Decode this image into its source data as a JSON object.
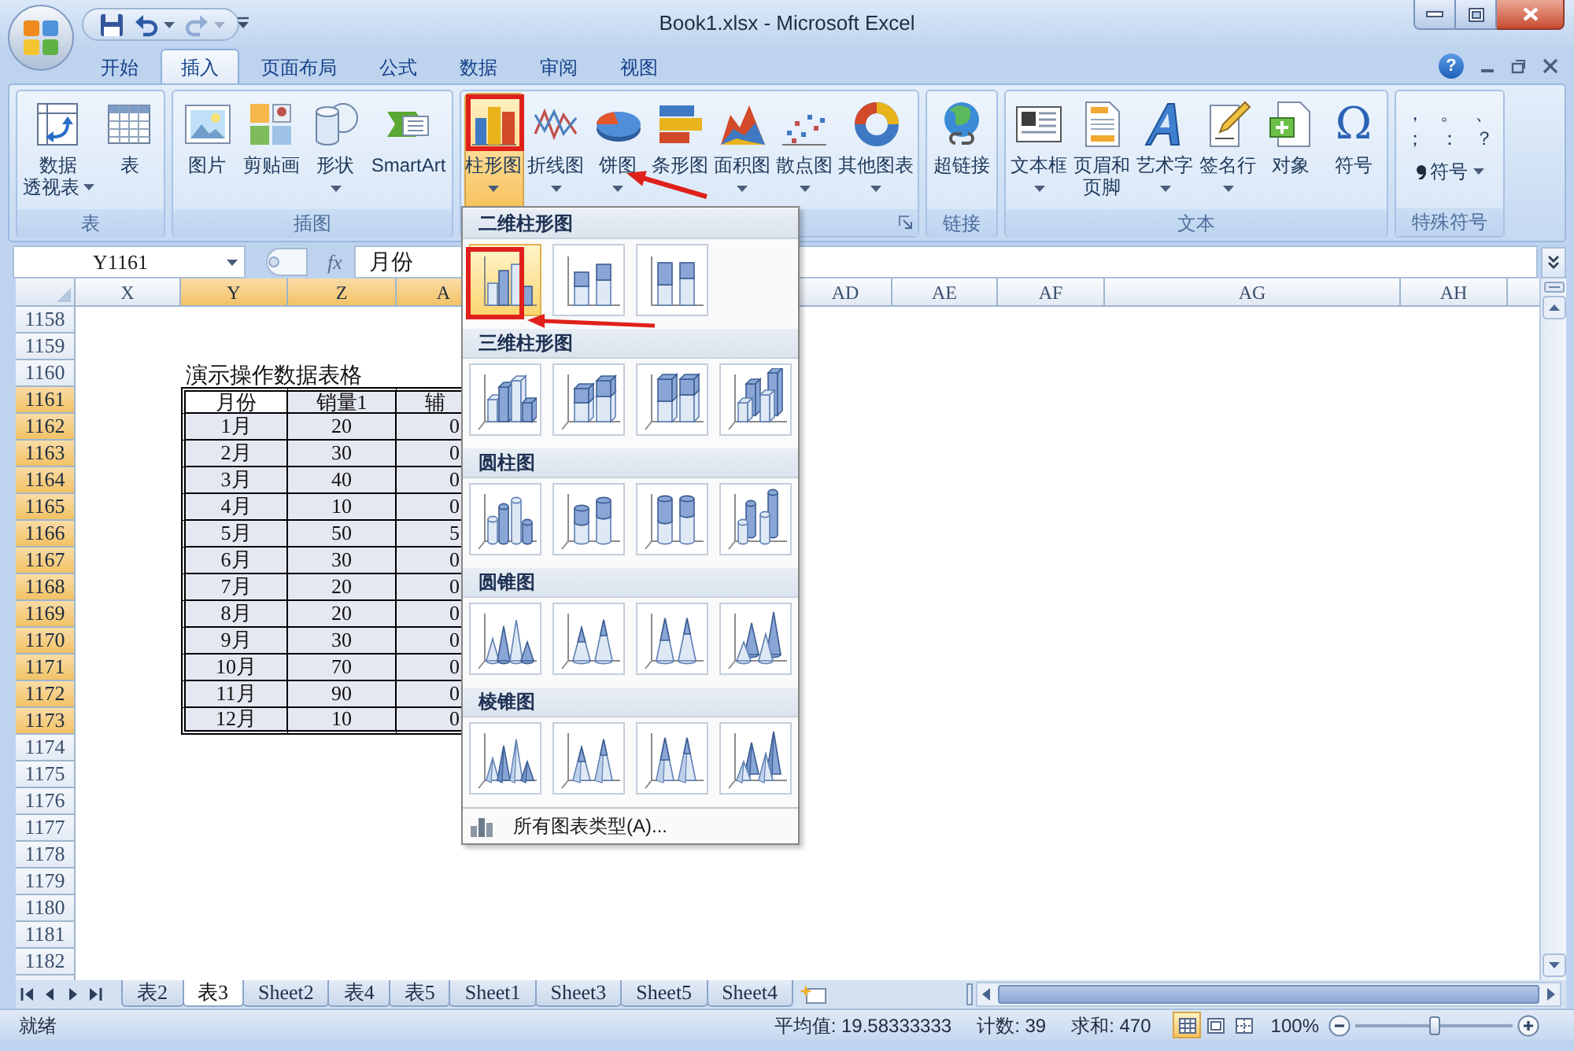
{
  "window": {
    "title": "Book1.xlsx - Microsoft Excel"
  },
  "quick_access": [
    {
      "kind": "save",
      "disabled": false
    },
    {
      "kind": "undo",
      "disabled": false
    },
    {
      "kind": "redo",
      "disabled": true
    }
  ],
  "ribbon_tabs": [
    {
      "label": "开始",
      "selected": false
    },
    {
      "label": "插入",
      "selected": true
    },
    {
      "label": "页面布局",
      "selected": false
    },
    {
      "label": "公式",
      "selected": false
    },
    {
      "label": "数据",
      "selected": false
    },
    {
      "label": "审阅",
      "selected": false
    },
    {
      "label": "视图",
      "selected": false
    }
  ],
  "ribbon_controls": {
    "help": "?"
  },
  "ribbon_groups": [
    {
      "label": "表",
      "launcher": false,
      "items": [
        {
          "kind": "pivot",
          "label": [
            "数据",
            "透视表"
          ],
          "dropdown": true,
          "selected": false
        },
        {
          "kind": "table",
          "label": [
            "表"
          ],
          "dropdown": false,
          "selected": false
        }
      ]
    },
    {
      "label": "插图",
      "launcher": false,
      "items": [
        {
          "kind": "picture",
          "label": [
            "图片"
          ],
          "dropdown": false,
          "selected": false
        },
        {
          "kind": "clipart",
          "label": [
            "剪贴画"
          ],
          "dropdown": false,
          "selected": false
        },
        {
          "kind": "shapes",
          "label": [
            "形状"
          ],
          "dropdown": true,
          "selected": false
        },
        {
          "kind": "smartart",
          "label": [
            "SmartArt"
          ],
          "dropdown": false,
          "selected": false
        }
      ]
    },
    {
      "launcher": true,
      "items": [
        {
          "kind": "column",
          "label": [
            "柱形图"
          ],
          "dropdown": true,
          "selected": true
        },
        {
          "kind": "line",
          "label": [
            "折线图"
          ],
          "dropdown": true,
          "selected": false
        },
        {
          "kind": "pie",
          "label": [
            "饼图"
          ],
          "dropdown": true,
          "selected": false
        },
        {
          "kind": "bar",
          "label": [
            "条形图"
          ],
          "dropdown": false,
          "selected": false
        },
        {
          "kind": "area",
          "label": [
            "面积图"
          ],
          "dropdown": true,
          "selected": false
        },
        {
          "kind": "scatter",
          "label": [
            "散点图"
          ],
          "dropdown": true,
          "selected": false
        },
        {
          "kind": "other",
          "label": [
            "其他图表"
          ],
          "dropdown": true,
          "selected": false
        }
      ]
    },
    {
      "label": "链接",
      "launcher": false,
      "items": [
        {
          "kind": "hyperlink",
          "label": [
            "超链接"
          ],
          "dropdown": false,
          "selected": false
        }
      ]
    },
    {
      "label": "文本",
      "launcher": false,
      "items": [
        {
          "kind": "textbox",
          "label": [
            "文本框"
          ],
          "dropdown": true,
          "selected": false
        },
        {
          "kind": "header",
          "label": [
            "页眉和",
            "页脚"
          ],
          "dropdown": false,
          "selected": false
        },
        {
          "kind": "wordart",
          "label": [
            "艺术字"
          ],
          "dropdown": true,
          "selected": false
        },
        {
          "kind": "signature",
          "label": [
            "签名行"
          ],
          "dropdown": true,
          "selected": false
        },
        {
          "kind": "object",
          "label": [
            "对象"
          ],
          "dropdown": false,
          "selected": false
        },
        {
          "kind": "symbol",
          "label": [
            "符号"
          ],
          "glyph": "Ω",
          "dropdown": false,
          "selected": false
        }
      ]
    },
    {
      "label": "特殊符号",
      "launcher": false,
      "symbols": [
        "，",
        "。",
        "、",
        "；",
        "：",
        "？"
      ],
      "menu": {
        "label": "符号",
        "dropdown": true
      }
    }
  ],
  "formula_bar": {
    "name_box": "Y1161",
    "function_label": "fx",
    "content": "月份"
  },
  "sheet": {
    "columns": [
      {
        "label": "X",
        "selected": false
      },
      {
        "label": "Y",
        "selected": true
      },
      {
        "label": "Z",
        "selected": true
      },
      {
        "label": "A",
        "selected": true
      },
      {
        "label": "AD",
        "selected": false
      },
      {
        "label": "AE",
        "selected": false
      },
      {
        "label": "AF",
        "selected": false
      },
      {
        "label": "AG",
        "selected": false
      },
      {
        "label": "AH",
        "selected": false
      }
    ],
    "rows": [
      {
        "label": "1158",
        "selected": false
      },
      {
        "label": "1159",
        "selected": false
      },
      {
        "label": "1160",
        "selected": false
      },
      {
        "label": "1161",
        "selected": true
      },
      {
        "label": "1162",
        "selected": true
      },
      {
        "label": "1163",
        "selected": true
      },
      {
        "label": "1164",
        "selected": true
      },
      {
        "label": "1165",
        "selected": true
      },
      {
        "label": "1166",
        "selected": true
      },
      {
        "label": "1167",
        "selected": true
      },
      {
        "label": "1168",
        "selected": true
      },
      {
        "label": "1169",
        "selected": true
      },
      {
        "label": "1170",
        "selected": true
      },
      {
        "label": "1171",
        "selected": true
      },
      {
        "label": "1172",
        "selected": true
      },
      {
        "label": "1173",
        "selected": true
      },
      {
        "label": "1174",
        "selected": false
      },
      {
        "label": "1175",
        "selected": false
      },
      {
        "label": "1176",
        "selected": false
      },
      {
        "label": "1177",
        "selected": false
      },
      {
        "label": "1178",
        "selected": false
      },
      {
        "label": "1179",
        "selected": false
      },
      {
        "label": "1180",
        "selected": false
      },
      {
        "label": "1181",
        "selected": false
      },
      {
        "label": "1182",
        "selected": false
      }
    ],
    "table": {
      "title": "演示操作数据表格",
      "header": [
        {
          "text": "月份",
          "active": true
        },
        {
          "text": "销量1",
          "active": false
        },
        {
          "text": "辅",
          "active": false
        }
      ],
      "rows": [
        [
          "1月",
          "20",
          "0"
        ],
        [
          "2月",
          "30",
          "0"
        ],
        [
          "3月",
          "40",
          "0"
        ],
        [
          "4月",
          "10",
          "0"
        ],
        [
          "5月",
          "50",
          "5"
        ],
        [
          "6月",
          "30",
          "0"
        ],
        [
          "7月",
          "20",
          "0"
        ],
        [
          "8月",
          "20",
          "0"
        ],
        [
          "9月",
          "30",
          "0"
        ],
        [
          "10月",
          "70",
          "0"
        ],
        [
          "11月",
          "90",
          "0"
        ],
        [
          "12月",
          "10",
          "0"
        ]
      ]
    }
  },
  "chart_menu": {
    "sections": [
      {
        "title": "二维柱形图",
        "kind": "bar2d",
        "options": [
          {
            "kind": "clustered",
            "selected": true
          },
          {
            "kind": "stacked",
            "selected": false
          },
          {
            "kind": "percent",
            "selected": false
          }
        ]
      },
      {
        "title": "三维柱形图",
        "kind": "bar3d",
        "options": [
          {
            "kind": "clustered",
            "selected": false
          },
          {
            "kind": "stacked",
            "selected": false
          },
          {
            "kind": "percent",
            "selected": false
          },
          {
            "kind": "depth",
            "selected": false
          }
        ]
      },
      {
        "title": "圆柱图",
        "kind": "cylinder",
        "options": [
          {
            "kind": "clustered",
            "selected": false
          },
          {
            "kind": "stacked",
            "selected": false
          },
          {
            "kind": "percent",
            "selected": false
          },
          {
            "kind": "depth",
            "selected": false
          }
        ]
      },
      {
        "title": "圆锥图",
        "kind": "cone",
        "options": [
          {
            "kind": "clustered",
            "selected": false
          },
          {
            "kind": "stacked",
            "selected": false
          },
          {
            "kind": "percent",
            "selected": false
          },
          {
            "kind": "depth",
            "selected": false
          }
        ]
      },
      {
        "title": "棱锥图",
        "kind": "pyramid",
        "options": [
          {
            "kind": "clustered",
            "selected": false
          },
          {
            "kind": "stacked",
            "selected": false
          },
          {
            "kind": "percent",
            "selected": false
          },
          {
            "kind": "depth",
            "selected": false
          }
        ]
      }
    ],
    "footer": "所有图表类型(A)..."
  },
  "sheet_tabs": [
    {
      "label": "表2",
      "selected": false
    },
    {
      "label": "表3",
      "selected": true
    },
    {
      "label": "Sheet2",
      "selected": false
    },
    {
      "label": "表4",
      "selected": false
    },
    {
      "label": "表5",
      "selected": false
    },
    {
      "label": "Sheet1",
      "selected": false
    },
    {
      "label": "Sheet3",
      "selected": false
    },
    {
      "label": "Sheet5",
      "selected": false
    },
    {
      "label": "Sheet4",
      "selected": false
    }
  ],
  "status_bar": {
    "mode": "就绪",
    "stats": [
      "平均值: 19.58333333",
      "计数: 39",
      "求和: 470"
    ],
    "views": [
      {
        "kind": "normal",
        "selected": true
      },
      {
        "kind": "page_layout",
        "selected": false
      },
      {
        "kind": "page_break",
        "selected": false
      }
    ],
    "zoom": {
      "reading": "100%",
      "level": 0.5
    }
  }
}
